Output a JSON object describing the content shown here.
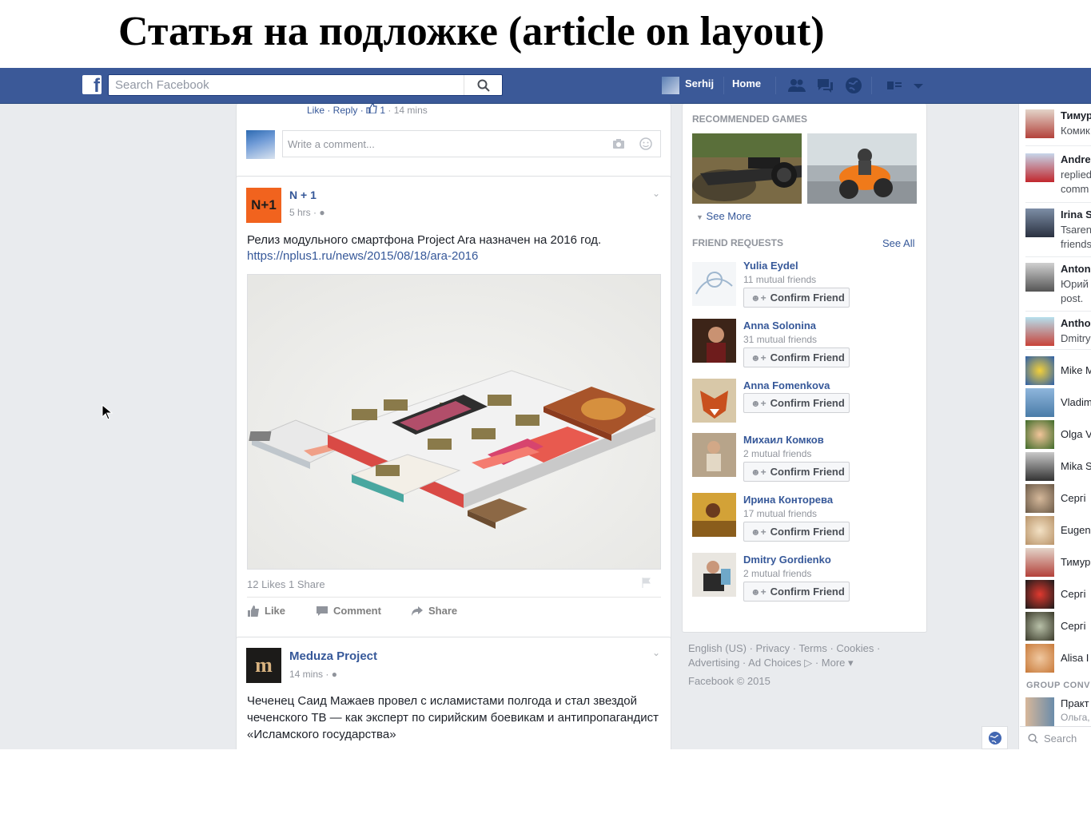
{
  "slide_title": "Статья на подложке (article on layout)",
  "topbar": {
    "search_placeholder": "Search Facebook",
    "user_name": "Serhij",
    "home_label": "Home"
  },
  "previous_comment": {
    "actions": "Like · Reply · ",
    "likes": "1",
    "time": " · 14 mins",
    "input_placeholder": "Write a comment..."
  },
  "post1": {
    "logo_text": "N+1",
    "author": "N + 1",
    "time": "5 hrs · ",
    "text": "Релиз модульного смартфона Project Ara назначен на 2016 год.",
    "link": "https://nplus1.ru/news/2015/08/18/ara-2016",
    "stats": "12 Likes   1 Share",
    "like_label": "Like",
    "comment_label": "Comment",
    "share_label": "Share"
  },
  "post2": {
    "logo_text": "m",
    "author": "Meduza Project",
    "time": "14 mins · ",
    "text": "Чеченец Саид Мажаев провел с исламистами полгода и стал звездой чеченского ТВ — как эксперт по сирийским боевикам и антипропагандист «Исламского государства»"
  },
  "right_column": {
    "games_heading": "RECOMMENDED GAMES",
    "see_more": "See More",
    "friend_requests_heading": "FRIEND REQUESTS",
    "see_all": "See All",
    "confirm_label": "Confirm Friend",
    "requests": [
      {
        "name": "Yulia Eydel",
        "mutual": "11 mutual friends"
      },
      {
        "name": "Anna Solonina",
        "mutual": "31 mutual friends"
      },
      {
        "name": "Anna Fomenkova",
        "mutual": ""
      },
      {
        "name": "Михаил Комков",
        "mutual": "2 mutual friends"
      },
      {
        "name": "Ирина Конторева",
        "mutual": "17 mutual friends"
      },
      {
        "name": "Dmitry Gordienko",
        "mutual": "2 mutual friends"
      }
    ],
    "footer_line1": "English (US) · Privacy · Terms · Cookies ·",
    "footer_line2": "Advertising · Ad Choices ▷ · More ▾",
    "footer_line3": "Facebook © 2015"
  },
  "chat": {
    "entries": [
      {
        "title": "Тимур",
        "sub": "Комик"
      },
      {
        "title": "Andre",
        "sub": "replied comm"
      },
      {
        "title": "Irina S",
        "sub": "Tsaren friends"
      },
      {
        "title": "Anton",
        "sub": "Юрий post."
      },
      {
        "title": "Antho",
        "sub": "Dmitry"
      }
    ],
    "contacts": [
      "Mike M",
      "Vladim",
      "Olga V",
      "Mika S",
      "Сергі",
      "Eugen",
      "Тимур",
      "Сергі",
      "Сергі",
      "Alisa I"
    ],
    "group_heading": "GROUP CONV",
    "group_title": "Практ",
    "group_sub": "Ольга,",
    "search_placeholder": "Search"
  },
  "colors": {
    "brand_blue": "#3b5998",
    "link_blue": "#365899",
    "background": "#e9ebee"
  }
}
